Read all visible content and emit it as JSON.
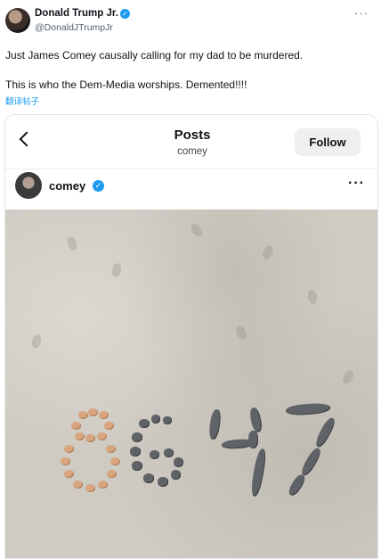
{
  "tweet": {
    "author_name": "Donald Trump Jr.",
    "author_handle": "@DonaldJTrumpJr",
    "more_icon": "more-horizontal-icon",
    "line1": "Just James Comey causally calling for my dad to be murdered.",
    "line2": "This is who the Dem-Media worships. Demented!!!!",
    "translate_label": "翻译帖子",
    "verified_color": "#1d9bf0"
  },
  "embed": {
    "title": "Posts",
    "subtitle": "comey",
    "follow_label": "Follow",
    "account_name": "comey",
    "back_icon": "chevron-left-icon",
    "more_icon": "more-horizontal-icon",
    "photo_text": "8647"
  }
}
